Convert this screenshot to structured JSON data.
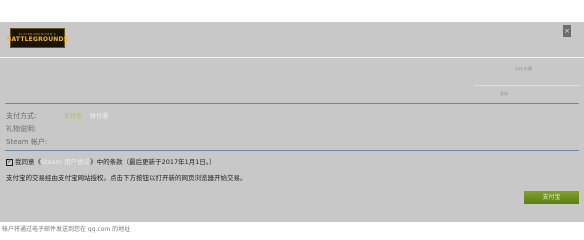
{
  "logo": {
    "small_text": "PLAYERUNKNOWN'S",
    "main_text": "BATTLEGROUNDS"
  },
  "close": {
    "label": "×"
  },
  "summary": {
    "line1": "小计 价格",
    "line2": "",
    "total": "总计"
  },
  "form": {
    "payment_label": "支付方式:",
    "payment_options": [
      "支付宝",
      "财付通"
    ],
    "gift_label": "礼物说明:",
    "account_label": "Steam 帐户:"
  },
  "agreement": {
    "prefix": "我同意《",
    "link": "Steam 用户协议",
    "suffix": "》中的条款（最后更新于2017年1月1日。）",
    "checked": "✓"
  },
  "notice": "支付宝的交易经由支付宝网站授权。点击下方按钮以打开新的网页浏览器开始交易。",
  "pay_button": "支付宝",
  "footer": "帐户将通过电子邮件发送到您在 qq.com 的地址"
}
